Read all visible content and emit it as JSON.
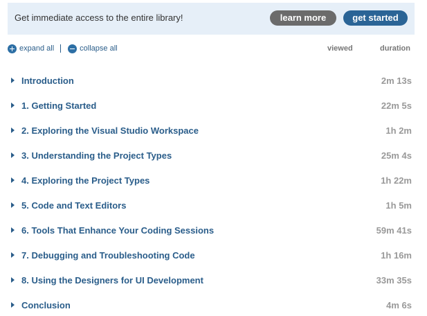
{
  "banner": {
    "text": "Get immediate access to the entire library!",
    "learn_more": "learn more",
    "get_started": "get started"
  },
  "controls": {
    "expand_all": "expand all",
    "collapse_all": "collapse all"
  },
  "columns": {
    "viewed": "viewed",
    "duration": "duration"
  },
  "modules": [
    {
      "title": "Introduction",
      "duration": "2m 13s"
    },
    {
      "title": "1. Getting Started",
      "duration": "22m 5s"
    },
    {
      "title": "2. Exploring the Visual Studio Workspace",
      "duration": "1h 2m"
    },
    {
      "title": "3. Understanding the Project Types",
      "duration": "25m 4s"
    },
    {
      "title": "4. Exploring the Project Types",
      "duration": "1h 22m"
    },
    {
      "title": "5. Code and Text Editors",
      "duration": "1h 5m"
    },
    {
      "title": "6. Tools That Enhance Your Coding Sessions",
      "duration": "59m 41s"
    },
    {
      "title": "7. Debugging and Troubleshooting Code",
      "duration": "1h 16m"
    },
    {
      "title": "8. Using the Designers for UI Development",
      "duration": "33m 35s"
    },
    {
      "title": "Conclusion",
      "duration": "4m 6s"
    }
  ]
}
